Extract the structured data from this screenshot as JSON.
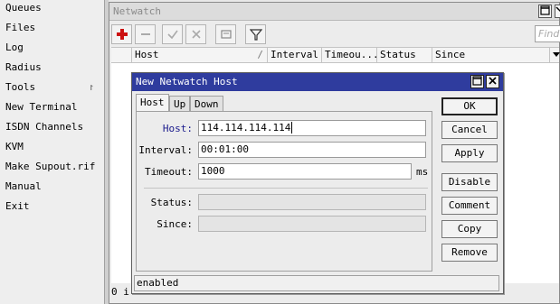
{
  "left_menu": {
    "items": [
      {
        "label": "Queues",
        "has_submenu": false
      },
      {
        "label": "Files",
        "has_submenu": false
      },
      {
        "label": "Log",
        "has_submenu": false
      },
      {
        "label": "Radius",
        "has_submenu": false
      },
      {
        "label": "Tools",
        "has_submenu": true,
        "submenu_glyph": "↾"
      },
      {
        "label": "New Terminal",
        "has_submenu": false
      },
      {
        "label": "ISDN Channels",
        "has_submenu": false
      },
      {
        "label": "KVM",
        "has_submenu": false
      },
      {
        "label": "Make Supout.rif",
        "has_submenu": false
      },
      {
        "label": "Manual",
        "has_submenu": false
      },
      {
        "label": "Exit",
        "has_submenu": false
      }
    ]
  },
  "netwatch": {
    "title": "Netwatch",
    "toolbar": {
      "add_icon": "plus-icon",
      "remove_icon": "minus-icon",
      "enable_icon": "check-icon",
      "disable_icon": "x-icon",
      "comment_icon": "note-icon",
      "filter_icon": "filter-icon",
      "find_placeholder": "Find"
    },
    "columns": [
      "Host",
      "Interval",
      "Timeou...",
      "Status",
      "Since"
    ],
    "footer_count": "0 i"
  },
  "dialog": {
    "title": "New Netwatch Host",
    "tabs": [
      "Host",
      "Up",
      "Down"
    ],
    "active_tab": "Host",
    "fields": {
      "host": {
        "label": "Host:",
        "value": "114.114.114.114"
      },
      "interval": {
        "label": "Interval:",
        "value": "00:01:00"
      },
      "timeout": {
        "label": "Timeout:",
        "value": "1000",
        "unit": "ms"
      },
      "status": {
        "label": "Status:",
        "value": ""
      },
      "since": {
        "label": "Since:",
        "value": ""
      }
    },
    "buttons": {
      "ok": "OK",
      "cancel": "Cancel",
      "apply": "Apply",
      "disable": "Disable",
      "comment": "Comment",
      "copy": "Copy",
      "remove": "Remove"
    },
    "status_bar": "enabled"
  },
  "colors": {
    "dialog_titlebar": "#2f3c9e",
    "add_icon": "#cc1111",
    "host_label": "#1a1a8c"
  }
}
